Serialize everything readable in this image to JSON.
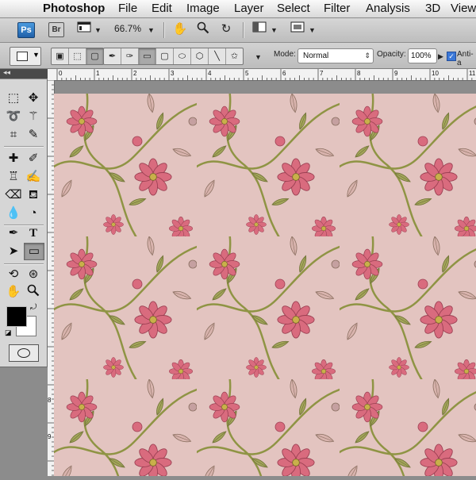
{
  "menubar": {
    "apple_icon": "apple-icon",
    "items": [
      "Photoshop",
      "File",
      "Edit",
      "Image",
      "Layer",
      "Select",
      "Filter",
      "Analysis",
      "3D",
      "View"
    ]
  },
  "appbar": {
    "ps_logo": "Ps",
    "br_logo": "Br",
    "zoom": "66.7%",
    "icons": [
      "screen-mode-icon",
      "hand-icon",
      "zoom-icon",
      "rotate-view-icon",
      "arrange-documents-icon",
      "screen-mode-toggle-icon"
    ]
  },
  "options": {
    "mode_label": "Mode:",
    "mode_value": "Normal",
    "opacity_label": "Opacity:",
    "opacity_value": "100%",
    "antialias_label": "Anti-a",
    "antialias_checked": true
  },
  "rulers": {
    "h_labels": [
      "0",
      "1",
      "2",
      "3",
      "4",
      "5",
      "6",
      "7",
      "8",
      "9",
      "10",
      "11"
    ],
    "v_labels": [
      "8",
      "9"
    ]
  },
  "colors": {
    "foreground": "#000000",
    "background": "#ffffff",
    "canvas_bg": "#e3c4c0",
    "flower": "#d96b7e",
    "leaf": "#9aa050"
  }
}
